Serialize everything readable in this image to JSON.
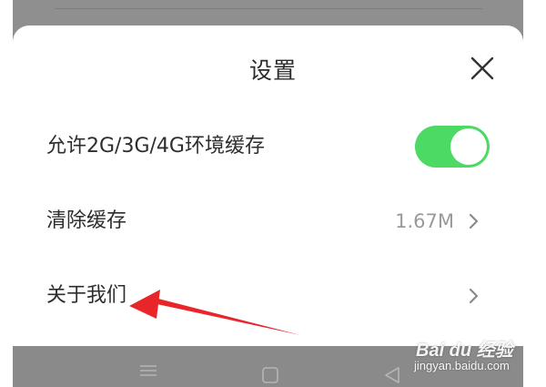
{
  "sheet": {
    "title": "设置",
    "close_icon": "close-icon"
  },
  "settings": {
    "cache_on_mobile": {
      "label": "允许2G/3G/4G环境缓存",
      "enabled": true
    },
    "clear_cache": {
      "label": "清除缓存",
      "value": "1.67M",
      "icon": "chevron-right-icon"
    },
    "about_us": {
      "label": "关于我们",
      "icon": "chevron-right-icon"
    }
  },
  "nav_bar": {
    "icons": [
      "menu-icon",
      "home-icon",
      "back-icon"
    ]
  },
  "watermark": {
    "logo": "Bai du 经验",
    "url": "jingyan.baidu.com"
  },
  "colors": {
    "toggle_on": "#4cd964",
    "annotation_arrow": "#e8262a",
    "overlay_gray": "#8f8f8f"
  }
}
